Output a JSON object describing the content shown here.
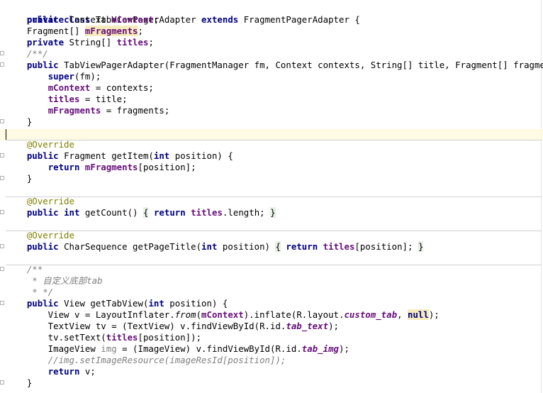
{
  "lines": {
    "l1": [
      "public",
      " ",
      "class",
      " TabViewPagerAdapter ",
      "extends",
      " FragmentPagerAdapter {"
    ],
    "l2": [
      "    ",
      "private",
      " Context ",
      "mContext",
      ";"
    ],
    "l3": [
      "    Fragment[] ",
      "mFragments",
      ";"
    ],
    "l4": [
      "    ",
      "private",
      " String[] ",
      "titles",
      ";"
    ],
    "l5": [
      "    /**/"
    ],
    "l6": [
      "    ",
      "public",
      " TabViewPagerAdapter(FragmentManager fm, Context contexts, String[] title, Fragment[] fragments) {"
    ],
    "l7": [
      "        ",
      "super",
      "(fm);"
    ],
    "l8": [
      "        ",
      "mContext",
      " = contexts;"
    ],
    "l9": [
      "        ",
      "titles",
      " = title;"
    ],
    "l10": [
      "        ",
      "mFragments",
      " = fragments;"
    ],
    "l11": [
      "    }"
    ],
    "l13": [
      "    @Override"
    ],
    "l14": [
      "    ",
      "public",
      " Fragment getItem(",
      "int",
      " position) {"
    ],
    "l15": [
      "        ",
      "return",
      " ",
      "mFragments",
      "[position];"
    ],
    "l16": [
      "    }"
    ],
    "l18": [
      "    @Override"
    ],
    "l19": [
      "    ",
      "public",
      " ",
      "int",
      " getCount() ",
      "{",
      " ",
      "return",
      " ",
      "titles",
      ".length; ",
      "}"
    ],
    "l21": [
      "    @Override"
    ],
    "l22": [
      "    ",
      "public",
      " CharSequence getPageTitle(",
      "int",
      " position) ",
      "{",
      " ",
      "return",
      " ",
      "titles",
      "[position]; ",
      "}"
    ],
    "l24": [
      "    /**"
    ],
    "l25": [
      "     * 自定义底部tab"
    ],
    "l26": [
      "     * */"
    ],
    "l27": [
      "    ",
      "public",
      " View getTabView(",
      "int",
      " position) {"
    ],
    "l28": [
      "        View v = LayoutInflater.",
      "from",
      "(",
      "mContext",
      ").inflate(R.layout.",
      "custom_tab",
      ", ",
      "null",
      ");"
    ],
    "l29": [
      "        TextView tv = (TextView) v.findViewById(R.id.",
      "tab_text",
      ");"
    ],
    "l30": [
      "        tv.setText(",
      "titles",
      "[position]);"
    ],
    "l31": [
      "        ImageView ",
      "img",
      " = (ImageView) v.findViewById(R.id.",
      "tab_img",
      ");"
    ],
    "l32": [
      "        //img.setImageResource(imageResId[position]);"
    ],
    "l33": [
      "        ",
      "return",
      " v;"
    ],
    "l34": [
      "    }"
    ]
  }
}
